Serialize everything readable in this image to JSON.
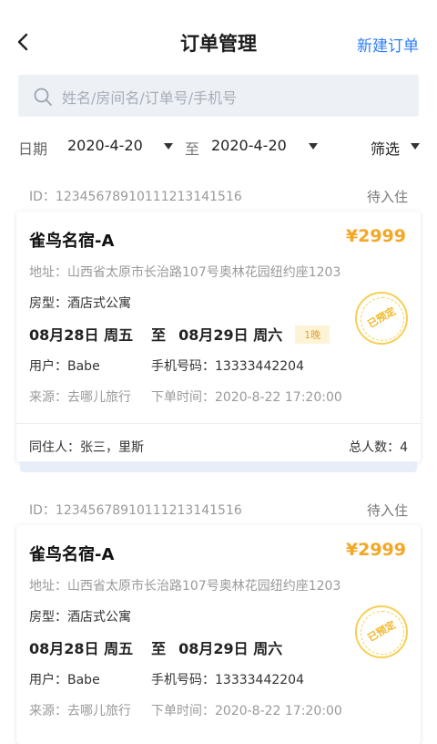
{
  "header": {
    "back_icon": "chevron-left-icon",
    "title": "订单管理",
    "new_order_label": "新建订单",
    "accent": "#2f7ef5"
  },
  "search": {
    "icon": "search-icon",
    "placeholder": "姓名/房间名/订单号/手机号"
  },
  "filter": {
    "date_label": "日期",
    "start_date": "2020-4-20",
    "to_label": "至",
    "end_date": "2020-4-20",
    "filter_label": "筛选"
  },
  "orders": [
    {
      "id": "ID：12345678910111213141516",
      "status": "待入住",
      "hotel": "雀鸟名宿-A",
      "price": "¥2999",
      "address": "地址：山西省太原市长治路107号奥林花园纽约座1203",
      "room_type": "房型：酒店式公寓",
      "checkin": "08月28日 周五",
      "to_label": "至",
      "checkout": "08月29日 周六",
      "nights": "1晚",
      "user": "用户：Babe",
      "phone": "手机号码：13333442204",
      "source": "来源：去哪儿旅行",
      "order_time": "下单时间：2020-8-22 17:20:00",
      "stamp": "已预定",
      "guests": "同住人：张三，里斯",
      "total": "总人数：4"
    },
    {
      "id": "ID：12345678910111213141516",
      "status": "待入住",
      "hotel": "雀鸟名宿-A",
      "price": "¥2999",
      "address": "地址：山西省太原市长治路107号奥林花园纽约座1203",
      "room_type": "房型：酒店式公寓",
      "checkin": "08月28日 周五",
      "to_label": "至",
      "checkout": "08月29日 周六",
      "user": "用户：Babe",
      "phone": "手机号码：13333442204",
      "source": "来源：去哪儿旅行",
      "order_time": "下单时间：2020-8-22 17:20:00",
      "stamp": "已预定"
    }
  ],
  "colors": {
    "price": "#f5a623",
    "stamp": "#f7cf55",
    "search_bg": "#edf1f6"
  }
}
